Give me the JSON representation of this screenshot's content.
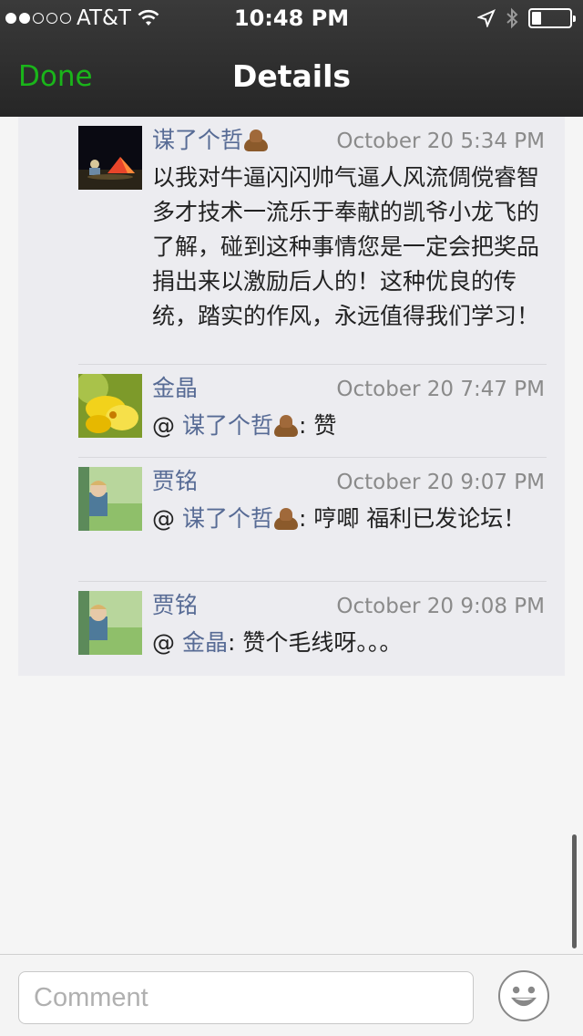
{
  "status_bar": {
    "carrier": "AT&T",
    "time": "10:48 PM",
    "signal_bars_filled": 2,
    "signal_bars_total": 5,
    "battery_level": 0.25
  },
  "nav": {
    "done_label": "Done",
    "title": "Details"
  },
  "comments": [
    {
      "name": "谋了个哲",
      "name_emoji": "pile-of-poo-icon",
      "time": "October 20 5:34 PM",
      "text": "以我对牛逼闪闪帅气逼人风流倜傥睿智多才技术一流乐于奉献的凯爷小龙飞的了解，碰到这种事情您是一定会把奖品捐出来以激励后人的！这种优良的传统，踏实的作风，永远值得我们学习！",
      "avatar": "avatar-tent-night"
    },
    {
      "name": "金晶",
      "time": "October 20 7:47 PM",
      "at": "@",
      "mention": "谋了个哲",
      "mention_emoji": "pile-of-poo-icon",
      "text": ": 赞",
      "avatar": "avatar-yellow-flower"
    },
    {
      "name": "贾铭",
      "time": "October 20 9:07 PM",
      "at": "@",
      "mention": "谋了个哲",
      "mention_emoji": "pile-of-poo-icon",
      "text": ": 哼唧 福利已发论坛！",
      "avatar": "avatar-child-window"
    },
    {
      "name": "贾铭",
      "time": "October 20 9:08 PM",
      "at": "@",
      "mention": "金晶",
      "text": ": 赞个毛线呀。。。",
      "avatar": "avatar-child-window"
    }
  ],
  "comment_bar": {
    "placeholder": "Comment",
    "emoji_button_icon": "smiley-face-icon"
  },
  "colors": {
    "done_green": "#1ab51a",
    "name_blue": "#576b95",
    "header_dark": "#2e2e2e"
  }
}
